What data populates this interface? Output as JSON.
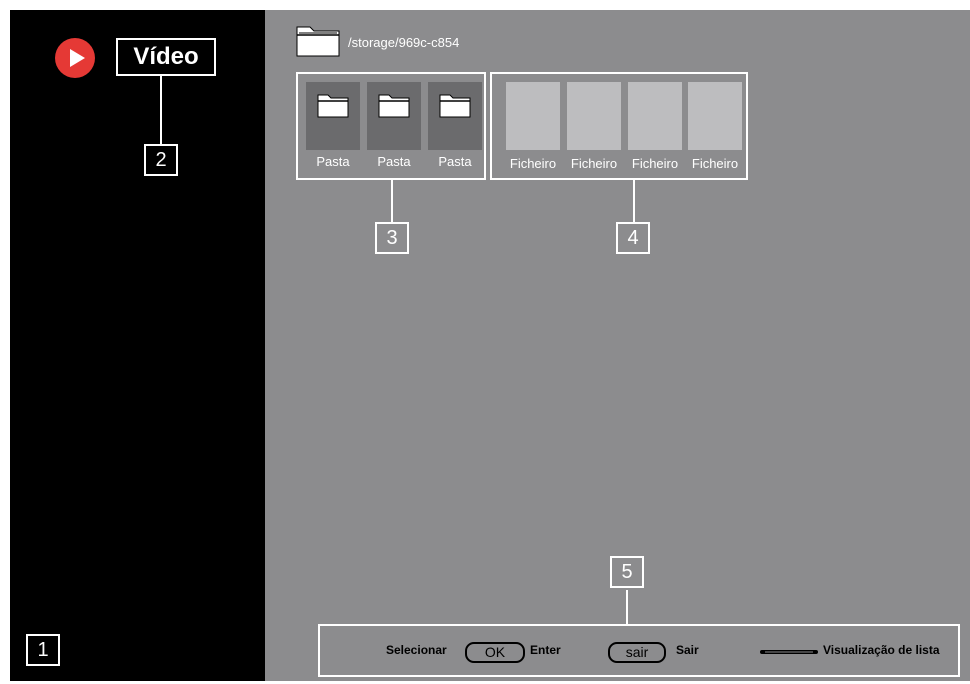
{
  "sidebar": {
    "title": "Vídeo",
    "play_icon": "play-circle-icon",
    "accent_color": "#e53935"
  },
  "path": {
    "icon": "folder-icon",
    "text": "/storage/969c-c854"
  },
  "folders": [
    {
      "label": "Pasta",
      "icon": "folder-icon"
    },
    {
      "label": "Pasta",
      "icon": "folder-icon"
    },
    {
      "label": "Pasta",
      "icon": "folder-icon"
    }
  ],
  "files": [
    {
      "label": "Ficheiro"
    },
    {
      "label": "Ficheiro"
    },
    {
      "label": "Ficheiro"
    },
    {
      "label": "Ficheiro"
    }
  ],
  "callouts": [
    "1",
    "2",
    "3",
    "4",
    "5"
  ],
  "footer": {
    "select_label": "Selecionar",
    "ok_key": "OK",
    "enter_label": "Enter",
    "exit_key": "sair",
    "exit_label": "Sair",
    "list_icon": "list-view-bar-icon",
    "list_view_label": "Visualização de lista"
  }
}
